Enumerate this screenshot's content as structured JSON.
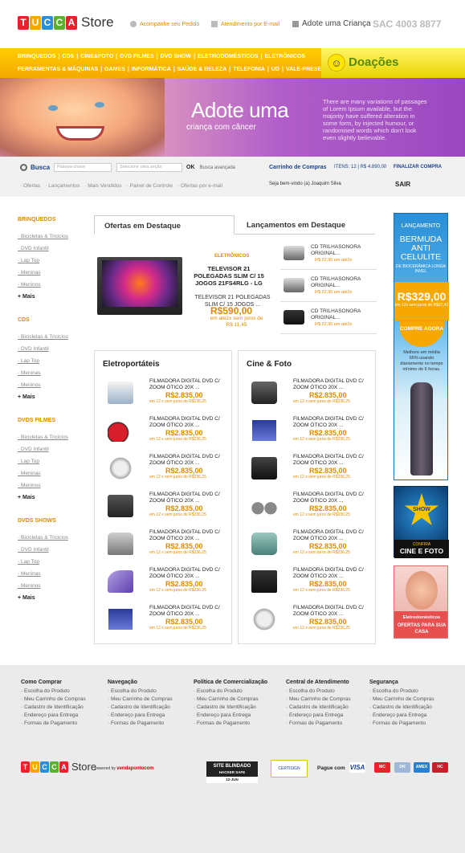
{
  "header": {
    "logo_letters": [
      "T",
      "U",
      "C",
      "C",
      "A"
    ],
    "logo_letter_colors": [
      "#e8222c",
      "#f7a800",
      "#2a8fd6",
      "#5bb030",
      "#e8222c"
    ],
    "logo_store": "Store",
    "links": [
      "Acompanhe seu Pedido",
      "Atendimento por E-mail"
    ],
    "adote": "Adote uma Criança",
    "sac": "SAC 4003 8877"
  },
  "categories": {
    "row1": [
      "BRINQUEDOS",
      "|",
      "CDS",
      "|",
      "CINE&FOTO",
      "|",
      "DVD FILMES",
      "|",
      "DVD SHOW",
      "|",
      "ELETRODOMÉSTICOS",
      "|",
      "ELETRÔNICOS"
    ],
    "row2": [
      "FERRAMENTAS & MÁQUINAS",
      "|",
      "GAMES",
      "|",
      "INFORMÁTICA",
      "|",
      "SAÚDE & BELEZA",
      "|",
      "TELEFONIA",
      "|",
      "UD",
      "|",
      "VALE-PRESENTE"
    ],
    "doacoes": "Doações"
  },
  "banner": {
    "title": "Adote uma",
    "subtitle": "criança com câncer",
    "text": "There are many variations of passages of Lorem Ipsum available, but the majority have suffered alteration in some form, by injected humour, or randomised words which don't look even slightly believable."
  },
  "search": {
    "label": "Busca",
    "placeholder": "Palavra-chave",
    "section_placeholder": "Selecione uma seção",
    "ok": "OK",
    "advanced": "Busca avançada",
    "cart": "Carrinho de Compras",
    "items": "ITENS: 12 | R$ 4.890,00",
    "checkout": "FINALIZAR COMPRA",
    "subnav": [
      "· Ofertas",
      "· Lançamentos",
      "· Mais Vendidos",
      "· Painel de Controle",
      "· Ofertas por e-mail"
    ],
    "welcome": "Seja bem-vindo (a) Joaquim Silva",
    "logout": "SAIR"
  },
  "sidebar": [
    {
      "title": "BRINQUEDOS",
      "items": [
        "Bicicletas & Triciclos",
        "DVD Infantil",
        "Lap Top",
        "Meninas",
        "Meninos"
      ],
      "more": "+ Mais"
    },
    {
      "title": "CDS",
      "items": [
        "Bicicletas & Triciclos",
        "DVD Infantil",
        "Lap Top",
        "Meninas",
        "Meninos"
      ],
      "more": "+ Mais"
    },
    {
      "title": "DVDS FILMES",
      "items": [
        "Bicicletas & Triciclos",
        "DVD Infantil",
        "Lap Top",
        "Meninas",
        "Meninos"
      ],
      "more": "+ Mais"
    },
    {
      "title": "DVDS SHOWS",
      "items": [
        "Bicicletas & Triciclos",
        "DVD Infantil",
        "Lap Top",
        "Meninas",
        "Meninos"
      ],
      "more": "+ Mais"
    }
  ],
  "tabs": [
    "Ofertas em Destaque",
    "Lançamentos em Destaque"
  ],
  "featured": {
    "category": "ELETRÔNICOS",
    "name": "TELEVISOR 21 POLEGADAS SLIM C/ 15 JOGOS 21FS4RLG - LG",
    "desc": "TELEVISOR 21 POLEGADAS SLIM C/ 15 JOGOS ...",
    "price": "R$590,00",
    "installments": "em até2x sem juros de R$ 11,45"
  },
  "launches": [
    {
      "name": "CD TRILHASONORA ORIGINAL...",
      "price": "R$ 22,90 em até2x"
    },
    {
      "name": "CD TRILHASONORA ORIGINAL...",
      "price": "R$ 22,90 em até2x"
    },
    {
      "name": "CD TRILHASONORA ORIGINAL...",
      "price": "R$ 22,90 em até2x"
    }
  ],
  "panels": [
    {
      "title": "Eletroportáteis",
      "items": [
        {
          "name": "FILMADORA DIGITAL DVD C/ ZOOM ÓTICO 20X ...",
          "price": "R$2.835,00",
          "inst": "em 12 x sem juros de R$236,25",
          "icon": "water-filter"
        },
        {
          "name": "FILMADORA DIGITAL DVD C/ ZOOM ÓTICO 20X ...",
          "price": "R$2.835,00",
          "inst": "em 12 x sem juros de R$236,25",
          "icon": "vacuum"
        },
        {
          "name": "FILMADORA DIGITAL DVD C/ ZOOM ÓTICO 20X ...",
          "price": "R$2.835,00",
          "inst": "em 12 x sem juros de R$236,25",
          "icon": "mixer"
        },
        {
          "name": "FILMADORA DIGITAL DVD C/ ZOOM ÓTICO 20X ...",
          "price": "R$2.835,00",
          "inst": "em 12 x sem juros de R$236,25",
          "icon": "coffee"
        },
        {
          "name": "FILMADORA DIGITAL DVD C/ ZOOM ÓTICO 20X ...",
          "price": "R$2.835,00",
          "inst": "em 12 x sem juros de R$236,25",
          "icon": "toaster"
        },
        {
          "name": "FILMADORA DIGITAL DVD C/ ZOOM ÓTICO 20X ...",
          "price": "R$2.835,00",
          "inst": "em 12 x sem juros de R$236,25",
          "icon": "iron"
        },
        {
          "name": "FILMADORA DIGITAL DVD C/ ZOOM ÓTICO 20X ...",
          "price": "R$2.835,00",
          "inst": "em 12 x sem juros de R$236,25",
          "icon": "memory"
        }
      ]
    },
    {
      "title": "Cine & Foto",
      "items": [
        {
          "name": "FILMADORA DIGITAL DVD C/ ZOOM ÓTICO 20X ...",
          "price": "R$2.835,00",
          "inst": "em 12 x sem juros de R$236,25",
          "icon": "camcorder"
        },
        {
          "name": "FILMADORA DIGITAL DVD C/ ZOOM ÓTICO 20X ...",
          "price": "R$2.835,00",
          "inst": "em 12 x sem juros de R$236,25",
          "icon": "memory"
        },
        {
          "name": "FILMADORA DIGITAL DVD C/ ZOOM ÓTICO 20X ...",
          "price": "R$2.835,00",
          "inst": "em 12 x sem juros de R$236,25",
          "icon": "camera"
        },
        {
          "name": "FILMADORA DIGITAL DVD C/ ZOOM ÓTICO 20X ...",
          "price": "R$2.835,00",
          "inst": "em 12 x sem juros de R$236,25",
          "icon": "lenses"
        },
        {
          "name": "FILMADORA DIGITAL DVD C/ ZOOM ÓTICO 20X ...",
          "price": "R$2.835,00",
          "inst": "em 12 x sem juros de R$236,25",
          "icon": "case"
        },
        {
          "name": "FILMADORA DIGITAL DVD C/ ZOOM ÓTICO 20X ...",
          "price": "R$2.835,00",
          "inst": "em 12 x sem juros de R$236,25",
          "icon": "memory-stick"
        },
        {
          "name": "FILMADORA DIGITAL DVD C/ ZOOM ÓTICO 20X ...",
          "price": "R$2.835,00",
          "inst": "em 12 x sem juros de R$236,25",
          "icon": "mixer"
        }
      ]
    }
  ],
  "ads": {
    "bermuda": {
      "tag": "LANÇAMENTO",
      "title": "BERMUDA ANTI CELULITE",
      "sub": "DE BIOCERÂMICA LONGA INVEL",
      "price": "R$329,00",
      "inst": "em 12x sem juros de R$27,42",
      "buy": "COMPRE AGORA",
      "note": "Melhore em média 65% usando diariamente no tempo mínimo de 6 horas."
    },
    "show": {
      "star": "SHOW",
      "confira": "CONFIRA",
      "label": "CINE E FOTO"
    },
    "eletro": {
      "a": "Eletrodomésticos",
      "b": "OFERTAS PARA SUA CASA"
    }
  },
  "footer": {
    "cols": [
      {
        "title": "Como Comprar",
        "links": [
          "Escolha do Produto",
          "Meu Carrinho de Compras",
          "Cadastro de Identificação",
          "Endereço para Entrega",
          "Formas de Pagamento"
        ]
      },
      {
        "title": "Navegação",
        "links": [
          "Escolha do Produto",
          "Meu Carrinho de Compras",
          "Cadastro de Identificação",
          "Endereço para Entrega",
          "Formas de Pagamento"
        ]
      },
      {
        "title": "Política de Comercialização",
        "links": [
          "Escolha do Produto",
          "Meu Carrinho de Compras",
          "Cadastro de Identificação",
          "Endereço para Entrega",
          "Formas de Pagamento"
        ]
      },
      {
        "title": "Central de Atendimento",
        "links": [
          "Escolha do Produto",
          "Meu Carrinho de Compras",
          "Cadastro de Identificação",
          "Endereço para Entrega",
          "Formas de Pagamento"
        ]
      },
      {
        "title": "Segurança",
        "links": [
          "Escolha do Produto",
          "Meu Carrinho de Compras",
          "Cadastro de Identificação",
          "Endereço para Entrega",
          "Formas de Pagamento"
        ]
      }
    ],
    "powered_by": "powered by",
    "powered_brand": "vendapontocom",
    "blindado": "SITE BLINDADO",
    "blindado_sub": "HACKER SAFE",
    "blindado_date": "12-JUN",
    "certisign": "CERTISIGN",
    "pague": "Pague com",
    "cards": [
      "VISA",
      "MC",
      "DN",
      "AMEX",
      "HC"
    ]
  }
}
